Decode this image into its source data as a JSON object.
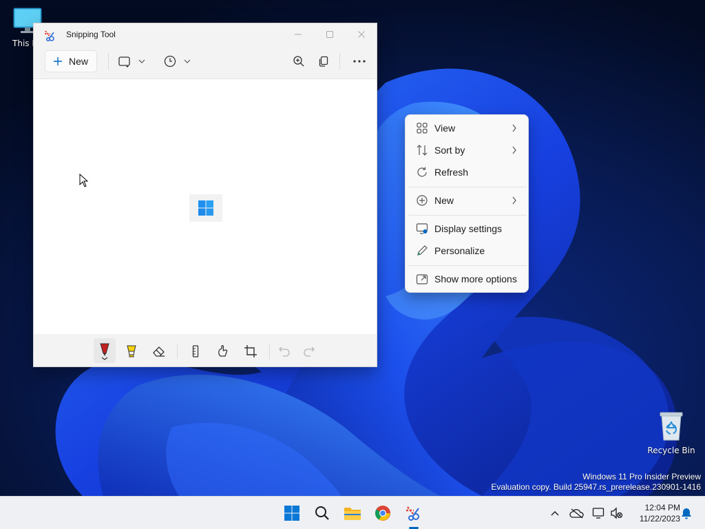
{
  "desktop": {
    "icons": [
      {
        "label": "This PC",
        "icon": "monitor-icon"
      },
      {
        "label": "Recycle Bin",
        "icon": "recycle-bin-icon"
      }
    ],
    "watermark": {
      "line1": "Windows 11 Pro Insider Preview",
      "line2": "Evaluation copy. Build 25947.rs_prerelease.230901-1416"
    }
  },
  "snipping_tool": {
    "title": "Snipping Tool",
    "new_label": "New",
    "toolbar_icons": [
      "rectangle-mode-icon",
      "chevron-down-icon",
      "timer-icon",
      "chevron-down-icon",
      "zoom-in-icon",
      "copy-icon",
      "more-icon"
    ],
    "markup_icons": [
      "ballpoint-pen-icon",
      "highlighter-icon",
      "eraser-icon",
      "ruler-icon",
      "touch-writing-icon",
      "crop-icon",
      "undo-icon",
      "redo-icon"
    ]
  },
  "context_menu": {
    "items": [
      {
        "label": "View",
        "icon": "view-grid-icon",
        "submenu": true
      },
      {
        "label": "Sort by",
        "icon": "sort-icon",
        "submenu": true
      },
      {
        "label": "Refresh",
        "icon": "refresh-icon",
        "submenu": false
      },
      {
        "label": "New",
        "icon": "new-plus-icon",
        "submenu": true
      },
      {
        "label": "Display settings",
        "icon": "display-settings-icon",
        "submenu": false
      },
      {
        "label": "Personalize",
        "icon": "personalize-pen-icon",
        "submenu": false
      },
      {
        "label": "Show more options",
        "icon": "show-more-options-icon",
        "submenu": false
      }
    ]
  },
  "taskbar": {
    "apps": [
      "start-icon",
      "search-icon",
      "file-explorer-icon",
      "chrome-icon",
      "snipping-tool-icon"
    ],
    "tray_icons": [
      "chevron-up-icon",
      "onedrive-icon",
      "network-icon",
      "volume-muted-icon",
      "notification-bell-icon"
    ],
    "time": "12:04 PM",
    "date": "11/22/2023"
  },
  "colors": {
    "accent": "#0067c0",
    "wallpaper_dark": "#06122e",
    "wallpaper_blue": "#1a4dff"
  }
}
